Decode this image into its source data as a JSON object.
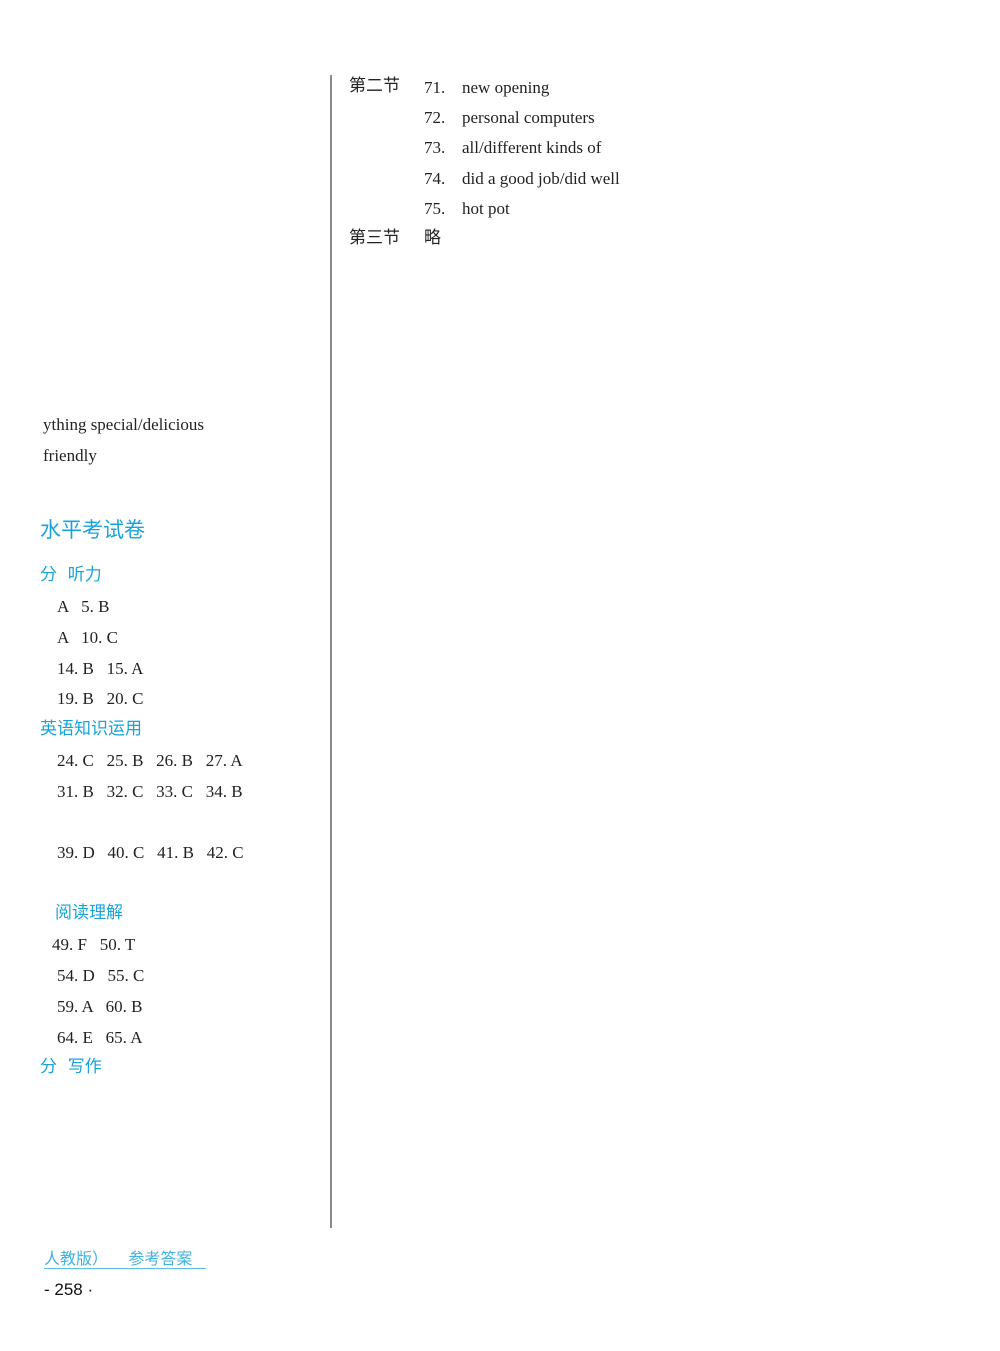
{
  "left_column": {
    "fragment_lines": [
      "ything special/delicious",
      "friendly"
    ],
    "exam_title": "水平考试卷",
    "sections": [
      {
        "heading": "分  听力",
        "rows": [
          "A   5. B",
          "A   10. C",
          "14. B   15. A",
          "19. B   20. C"
        ]
      },
      {
        "heading": "英语知识运用",
        "rows": [
          "24. C   25. B   26. B   27. A",
          "31. B   32. C   33. C   34. B",
          "39. D   40. C   41. B   42. C"
        ]
      },
      {
        "heading": "阅读理解",
        "rows": [
          "49. F   50. T",
          "54. D   55. C",
          "59. A   60. B",
          "64. E   65. A"
        ]
      },
      {
        "heading": "分  写作",
        "rows": []
      }
    ]
  },
  "right_column": {
    "section2_label": "第二节",
    "section2_items": [
      {
        "num": "71.",
        "text": "new opening"
      },
      {
        "num": "72.",
        "text": "personal computers"
      },
      {
        "num": "73.",
        "text": "all/different kinds of"
      },
      {
        "num": "74.",
        "text": "did a good job/did well"
      },
      {
        "num": "75.",
        "text": "hot pot"
      }
    ],
    "section3_label": "第三节",
    "section3_text": "略"
  },
  "footer": {
    "book_title": "人教版）    参考答案",
    "page_number": "- 258 ·"
  },
  "colors": {
    "accent_blue": "#1aa3d8",
    "text": "#222222"
  }
}
